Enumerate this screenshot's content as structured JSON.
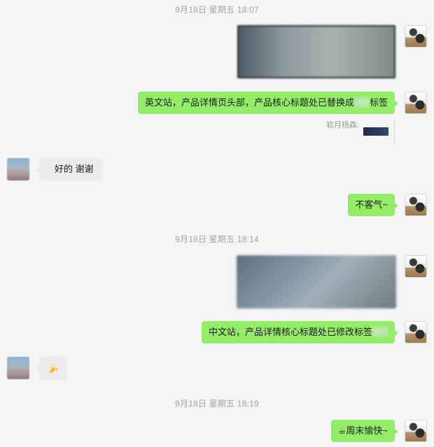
{
  "timestamps": [
    "9月18日 星期五 18:07",
    "9月18日 星期五 18:14",
    "9月18日 星期五 18:19"
  ],
  "messages": {
    "m2": {
      "text_prefix": "英文站，产品详情页头部，产品核心标题处已替换成",
      "text_suffix": "标签"
    },
    "m2_quote": {
      "sender": "软月杨森:"
    },
    "m3": {
      "text": "好的 谢谢"
    },
    "m4": {
      "text": "不客气~"
    },
    "m6": {
      "text": "中文站，产品详情核心标题处已修改标签"
    },
    "m7": {
      "emoji": "🍌"
    },
    "m8": {
      "emoji": "☕",
      "text": "周末愉快~"
    }
  },
  "colors": {
    "self_bubble": "#95ec69",
    "peer_bubble": "#ececec",
    "background": "#f5f5f7",
    "timestamp": "#a3a3a3"
  },
  "icons": {
    "self_avatar": "avatar",
    "peer_avatar": "avatar"
  }
}
